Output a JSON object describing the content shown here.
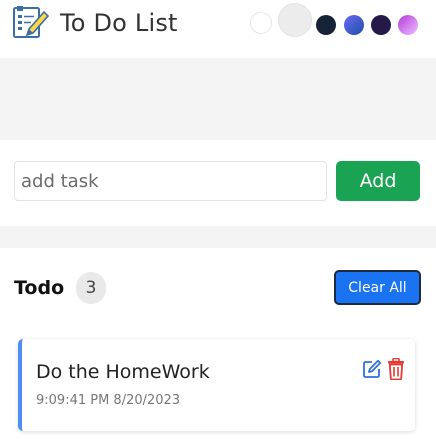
{
  "header": {
    "title": "To Do List",
    "logo_icon": "checklist-edit-icon",
    "theme_swatches": [
      {
        "name": "white",
        "color": "#ffffff"
      },
      {
        "name": "light",
        "color": "#ececec"
      },
      {
        "name": "dark",
        "color": "#162236"
      },
      {
        "name": "blue",
        "color": "#1f4fa8"
      },
      {
        "name": "purple",
        "color": "#231a4a"
      },
      {
        "name": "violet",
        "color": "#b13ad9"
      }
    ]
  },
  "input": {
    "placeholder": "add task",
    "value": "",
    "add_label": "Add"
  },
  "list": {
    "heading": "Todo",
    "count": "3",
    "clear_label": "Clear All",
    "items": [
      {
        "text": "Do the HomeWork",
        "time": "9:09:41 PM 8/20/2023"
      }
    ]
  },
  "colors": {
    "add_button": "#1aa352",
    "clear_button": "#1a73f0",
    "card_accent": "#4d8ef0",
    "edit_icon": "#2f6fe0",
    "delete_icon": "#e53935"
  }
}
